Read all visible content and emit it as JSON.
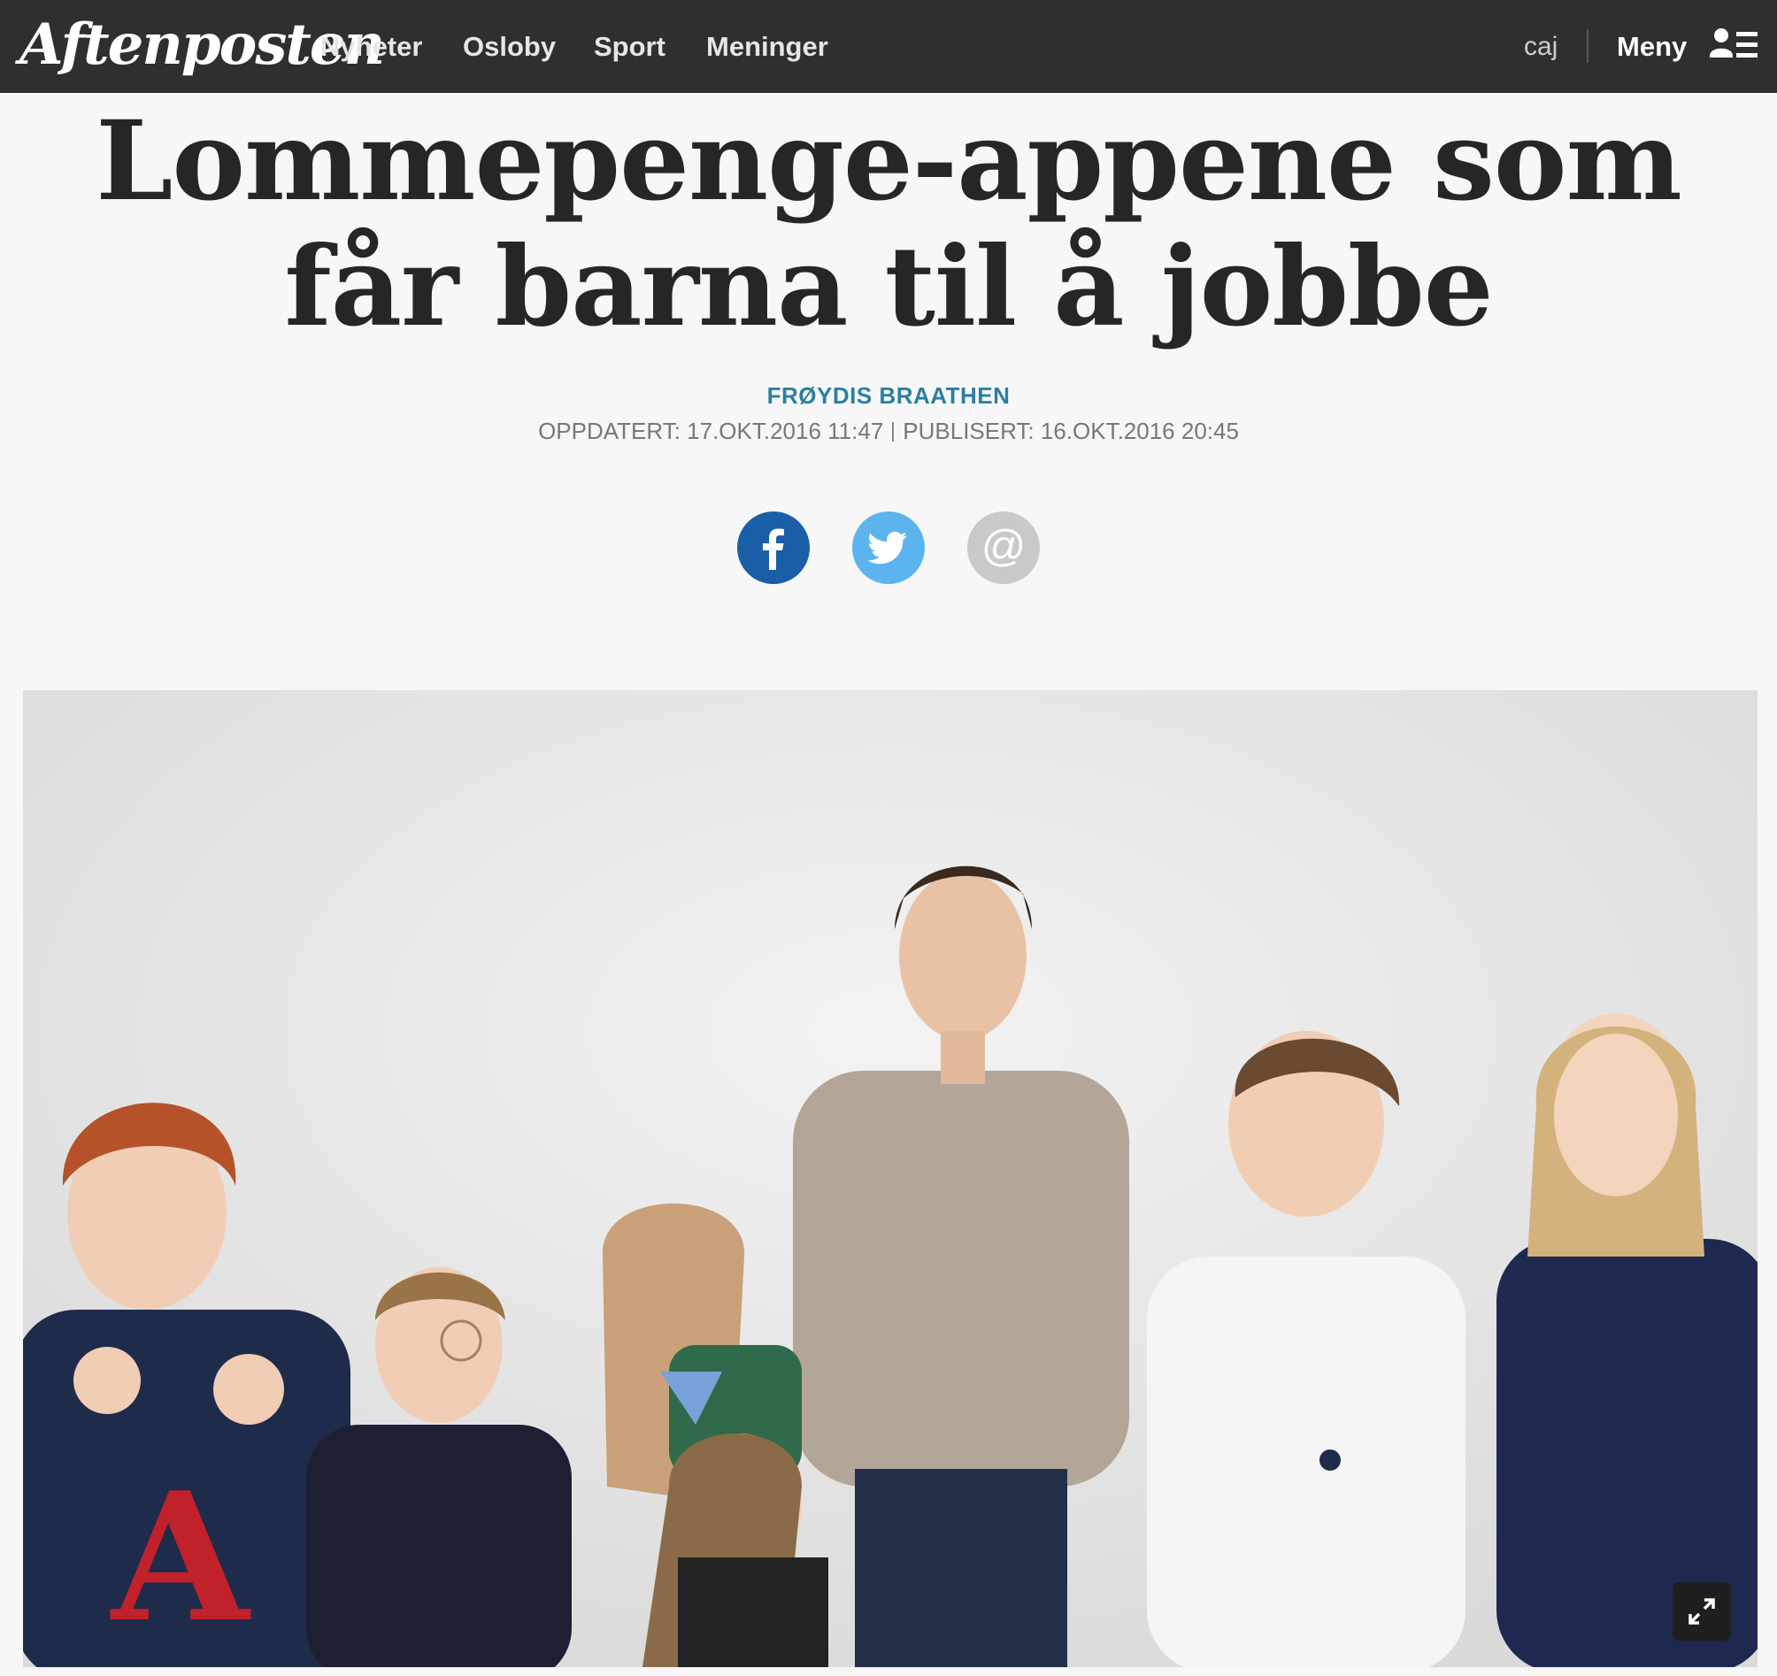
{
  "header": {
    "logo": "Aftenposten",
    "nav": [
      "Nyheter",
      "Osloby",
      "Sport",
      "Meninger"
    ],
    "user": "caj",
    "menu_label": "Meny",
    "menu_icon": "user-menu-icon"
  },
  "article": {
    "headline": "Lommepenge-appene som får barna til å jobbe",
    "author": "FRØYDIS BRAATHEN",
    "updated": "OPPDATERT: 17.OKT.2016 11:47",
    "published": "PUBLISERT: 16.OKT.2016 20:45"
  },
  "share": {
    "facebook_color": "#1a5ea8",
    "twitter_color": "#5bb4ee",
    "email_color": "#c9c9c9",
    "icons": [
      "facebook-icon",
      "twitter-icon",
      "email-icon"
    ]
  },
  "hero": {
    "expand_icon": "expand-icon"
  }
}
